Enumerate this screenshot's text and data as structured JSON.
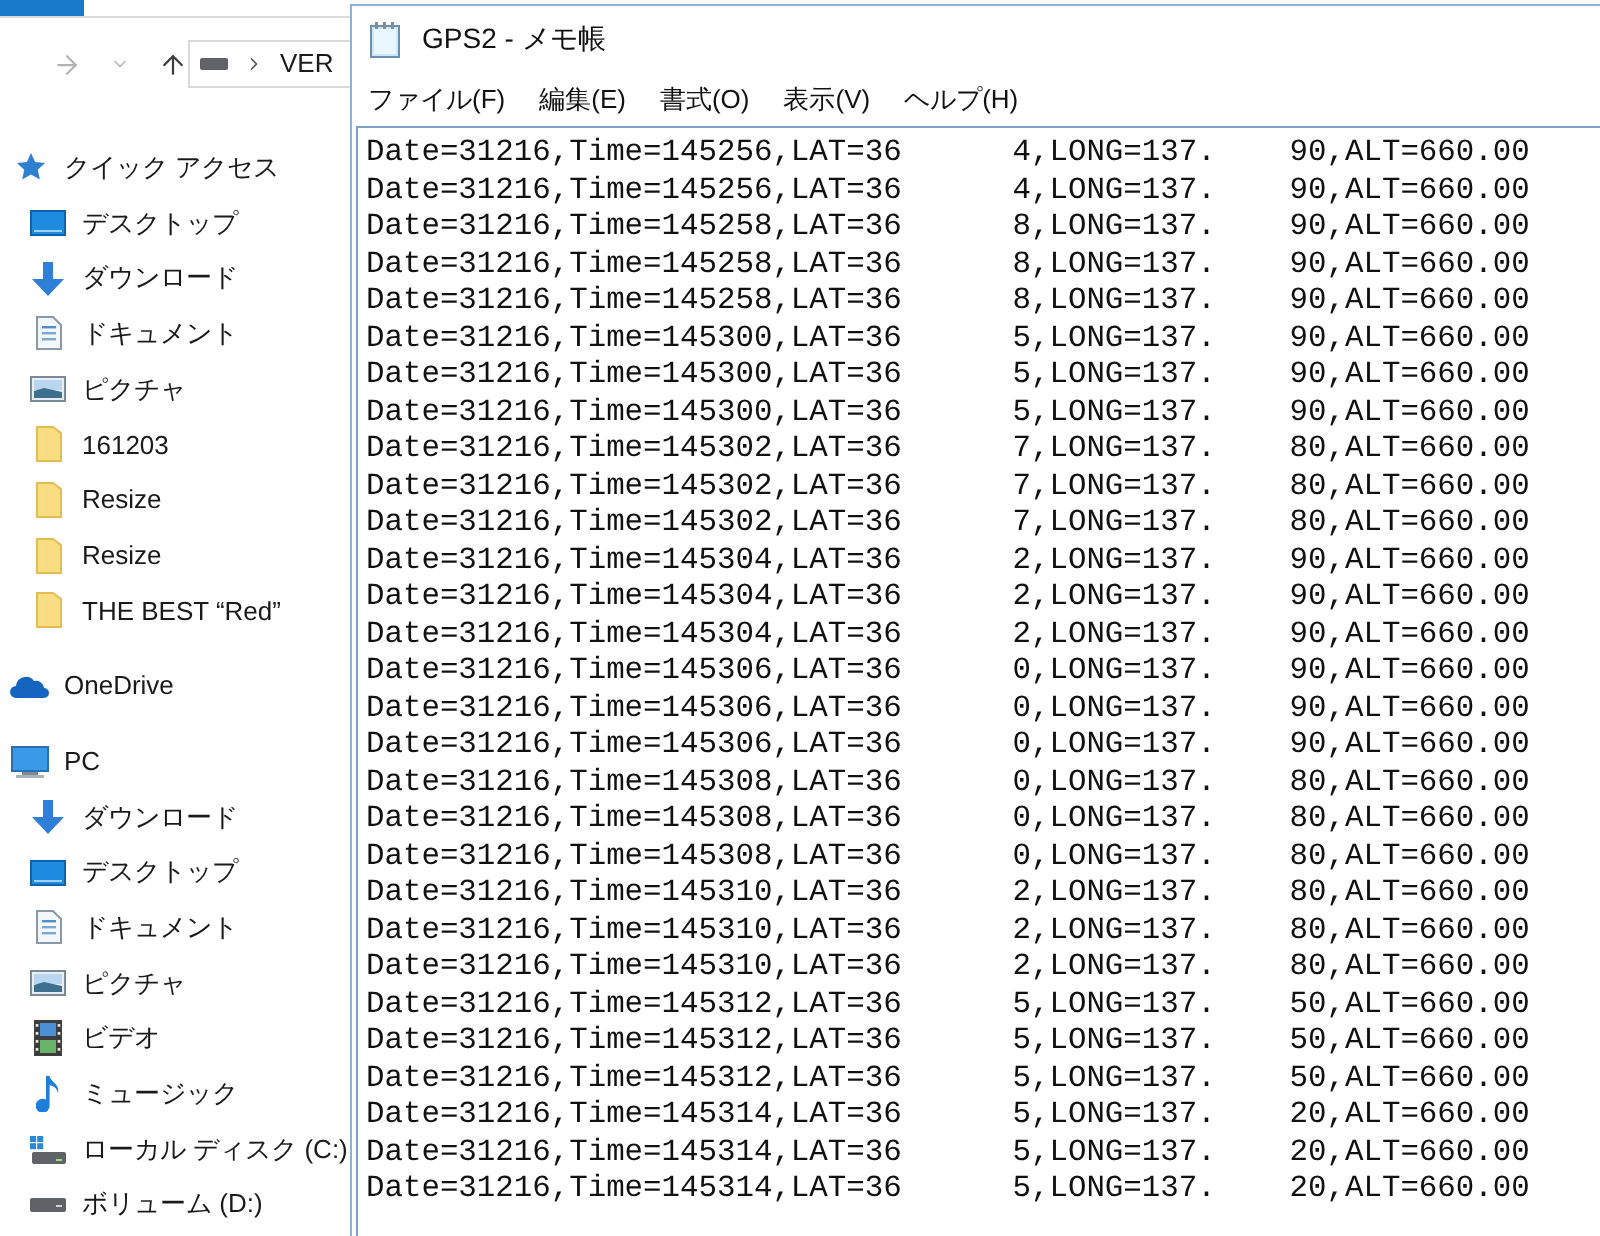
{
  "explorer": {
    "nav_buttons": [
      {
        "kind": "forward",
        "disabled": true
      },
      {
        "kind": "recent",
        "disabled": true
      },
      {
        "kind": "up",
        "disabled": false
      }
    ],
    "address": {
      "path": "VER"
    },
    "sidebar": [
      {
        "label": "クイック アクセス",
        "kind": "star",
        "children": [
          {
            "label": "デスクトップ",
            "kind": "desktop"
          },
          {
            "label": "ダウンロード",
            "kind": "download"
          },
          {
            "label": "ドキュメント",
            "kind": "document"
          },
          {
            "label": "ピクチャ",
            "kind": "picture"
          },
          {
            "label": "161203",
            "kind": "folder"
          },
          {
            "label": "Resize",
            "kind": "folder"
          },
          {
            "label": "Resize",
            "kind": "folder"
          },
          {
            "label": "THE BEST “Red”",
            "kind": "folder"
          }
        ]
      },
      {
        "label": "OneDrive",
        "kind": "cloud"
      },
      {
        "label": "PC",
        "kind": "computer",
        "children": [
          {
            "label": "ダウンロード",
            "kind": "download"
          },
          {
            "label": "デスクトップ",
            "kind": "desktop"
          },
          {
            "label": "ドキュメント",
            "kind": "document"
          },
          {
            "label": "ピクチャ",
            "kind": "picture"
          },
          {
            "label": "ビデオ",
            "kind": "video"
          },
          {
            "label": "ミュージック",
            "kind": "music"
          },
          {
            "label": "ローカル ディスク (C:)",
            "kind": "system-drive"
          },
          {
            "label": "ボリューム (D:)",
            "kind": "drive"
          }
        ]
      }
    ]
  },
  "notepad": {
    "title": "GPS2 - メモ帳",
    "menu": [
      "ファイル(F)",
      "編集(E)",
      "書式(O)",
      "表示(V)",
      "ヘルプ(H)"
    ],
    "lines": [
      [
        "Date=31216,Time=145256,LAT=36",
        "4,LONG=137.",
        "90,ALT=660.00"
      ],
      [
        "Date=31216,Time=145256,LAT=36",
        "4,LONG=137.",
        "90,ALT=660.00"
      ],
      [
        "Date=31216,Time=145258,LAT=36",
        "8,LONG=137.",
        "90,ALT=660.00"
      ],
      [
        "Date=31216,Time=145258,LAT=36",
        "8,LONG=137.",
        "90,ALT=660.00"
      ],
      [
        "Date=31216,Time=145258,LAT=36",
        "8,LONG=137.",
        "90,ALT=660.00"
      ],
      [
        "Date=31216,Time=145300,LAT=36",
        "5,LONG=137.",
        "90,ALT=660.00"
      ],
      [
        "Date=31216,Time=145300,LAT=36",
        "5,LONG=137.",
        "90,ALT=660.00"
      ],
      [
        "Date=31216,Time=145300,LAT=36",
        "5,LONG=137.",
        "90,ALT=660.00"
      ],
      [
        "Date=31216,Time=145302,LAT=36",
        "7,LONG=137.",
        "80,ALT=660.00"
      ],
      [
        "Date=31216,Time=145302,LAT=36",
        "7,LONG=137.",
        "80,ALT=660.00"
      ],
      [
        "Date=31216,Time=145302,LAT=36",
        "7,LONG=137.",
        "80,ALT=660.00"
      ],
      [
        "Date=31216,Time=145304,LAT=36",
        "2,LONG=137.",
        "90,ALT=660.00"
      ],
      [
        "Date=31216,Time=145304,LAT=36",
        "2,LONG=137.",
        "90,ALT=660.00"
      ],
      [
        "Date=31216,Time=145304,LAT=36",
        "2,LONG=137.",
        "90,ALT=660.00"
      ],
      [
        "Date=31216,Time=145306,LAT=36",
        "0,LONG=137.",
        "90,ALT=660.00"
      ],
      [
        "Date=31216,Time=145306,LAT=36",
        "0,LONG=137.",
        "90,ALT=660.00"
      ],
      [
        "Date=31216,Time=145306,LAT=36",
        "0,LONG=137.",
        "90,ALT=660.00"
      ],
      [
        "Date=31216,Time=145308,LAT=36",
        "0,LONG=137.",
        "80,ALT=660.00"
      ],
      [
        "Date=31216,Time=145308,LAT=36",
        "0,LONG=137.",
        "80,ALT=660.00"
      ],
      [
        "Date=31216,Time=145308,LAT=36",
        "0,LONG=137.",
        "80,ALT=660.00"
      ],
      [
        "Date=31216,Time=145310,LAT=36",
        "2,LONG=137.",
        "80,ALT=660.00"
      ],
      [
        "Date=31216,Time=145310,LAT=36",
        "2,LONG=137.",
        "80,ALT=660.00"
      ],
      [
        "Date=31216,Time=145310,LAT=36",
        "2,LONG=137.",
        "80,ALT=660.00"
      ],
      [
        "Date=31216,Time=145312,LAT=36",
        "5,LONG=137.",
        "50,ALT=660.00"
      ],
      [
        "Date=31216,Time=145312,LAT=36",
        "5,LONG=137.",
        "50,ALT=660.00"
      ],
      [
        "Date=31216,Time=145312,LAT=36",
        "5,LONG=137.",
        "50,ALT=660.00"
      ],
      [
        "Date=31216,Time=145314,LAT=36",
        "5,LONG=137.",
        "20,ALT=660.00"
      ],
      [
        "Date=31216,Time=145314,LAT=36",
        "5,LONG=137.",
        "20,ALT=660.00"
      ],
      [
        "Date=31216,Time=145314,LAT=36",
        "5,LONG=137.",
        "20,ALT=660.00"
      ]
    ]
  }
}
